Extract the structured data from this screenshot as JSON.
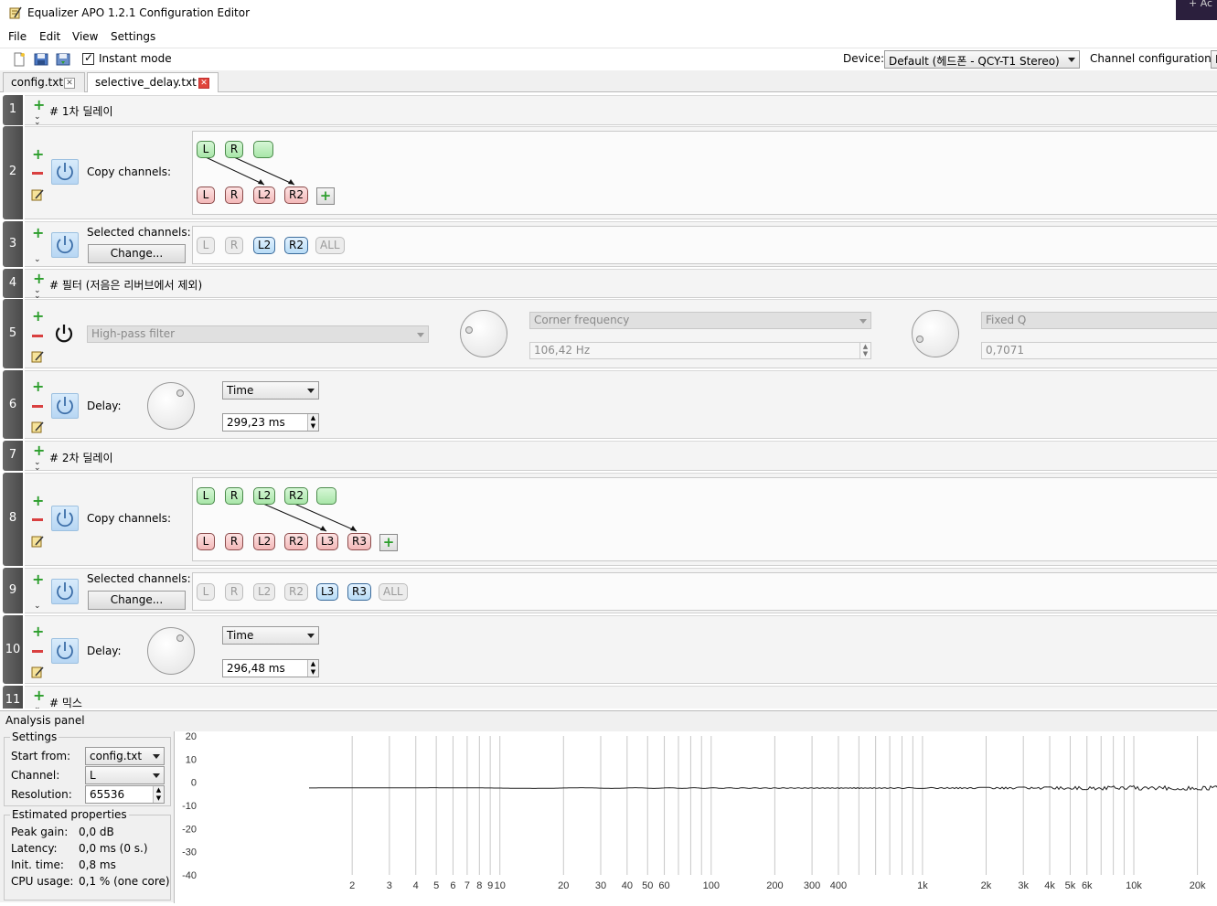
{
  "window": {
    "title": "Equalizer APO 1.2.1 Configuration Editor",
    "corner_text": "+ Ac"
  },
  "menu": [
    "File",
    "Edit",
    "View",
    "Settings"
  ],
  "toolbar": {
    "instant_mode_label": "Instant mode",
    "instant_mode_checked": "✓",
    "device_label": "Device:",
    "device_value": "Default (헤드폰 - QCY-T1 Stereo)",
    "channel_config_label": "Channel configuration:",
    "channel_config_value": "F"
  },
  "tabs": [
    {
      "label": "config.txt",
      "active": false
    },
    {
      "label": "selective_delay.txt",
      "active": true
    }
  ],
  "rows": {
    "r1": {
      "num": "1",
      "comment": "# 1차 딜레이"
    },
    "r2": {
      "num": "2",
      "label": "Copy channels:",
      "sources": [
        "L",
        "R",
        ""
      ],
      "targets": [
        "L",
        "R",
        "L2",
        "R2"
      ]
    },
    "r3": {
      "num": "3",
      "label": "Selected channels:",
      "button": "Change...",
      "chips": [
        "L",
        "R",
        "L2",
        "R2",
        "ALL"
      ]
    },
    "r4": {
      "num": "4",
      "comment": "# 필터 (저음은 리버브에서 제외)"
    },
    "r5": {
      "num": "5",
      "filter": "High-pass filter",
      "corner_mode": "Corner frequency",
      "frequency": "106,42 Hz",
      "q_mode": "Fixed Q",
      "q_value": "0,7071"
    },
    "r6": {
      "num": "6",
      "label": "Delay:",
      "mode": "Time",
      "value": "299,23 ms"
    },
    "r7": {
      "num": "7",
      "comment": "# 2차 딜레이"
    },
    "r8": {
      "num": "8",
      "label": "Copy channels:",
      "sources": [
        "L",
        "R",
        "L2",
        "R2",
        ""
      ],
      "targets": [
        "L",
        "R",
        "L2",
        "R2",
        "L3",
        "R3"
      ]
    },
    "r9": {
      "num": "9",
      "label": "Selected channels:",
      "button": "Change...",
      "chips": [
        "L",
        "R",
        "L2",
        "R2",
        "L3",
        "R3",
        "ALL"
      ]
    },
    "r10": {
      "num": "10",
      "label": "Delay:",
      "mode": "Time",
      "value": "296,48 ms"
    },
    "r11": {
      "num": "11",
      "comment": "# 믹스"
    }
  },
  "analysis": {
    "title": "Analysis panel",
    "settings_title": "Settings",
    "start_from_label": "Start from:",
    "start_from_value": "config.txt",
    "channel_label": "Channel:",
    "channel_value": "L",
    "resolution_label": "Resolution:",
    "resolution_value": "65536",
    "estimated_title": "Estimated properties",
    "peak_gain_label": "Peak gain:",
    "peak_gain_value": "0,0 dB",
    "latency_label": "Latency:",
    "latency_value": "0,0 ms (0 s.)",
    "init_time_label": "Init. time:",
    "init_time_value": "0,8 ms",
    "cpu_label": "CPU usage:",
    "cpu_value": "0,1 % (one core)",
    "y_ticks": [
      "20",
      "10",
      "0",
      "-10",
      "-20",
      "-30",
      "-40"
    ],
    "x_ticks": [
      "2",
      "3",
      "4",
      "5",
      "6",
      "7",
      "8",
      "9",
      "10",
      "20",
      "30",
      "40",
      "50",
      "60",
      "100",
      "200",
      "300",
      "400",
      "1k",
      "2k",
      "3k",
      "4k",
      "5k",
      "6k",
      "10k",
      "20k"
    ]
  }
}
